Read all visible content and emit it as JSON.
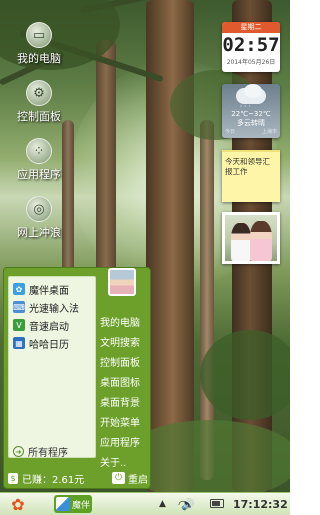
{
  "desktop_icons": [
    {
      "label": "我的电脑",
      "icon": "computer-icon"
    },
    {
      "label": "控制面板",
      "icon": "control-panel-icon"
    },
    {
      "label": "应用程序",
      "icon": "apps-icon"
    },
    {
      "label": "网上冲浪",
      "icon": "globe-icon"
    }
  ],
  "clock_widget": {
    "weekday": "星期二",
    "time": "02:57",
    "date": "2014年05月26日"
  },
  "weather_widget": {
    "temp": "22℃~32℃",
    "condition": "多云转晴",
    "left_label": "今日",
    "right_label": "上海市"
  },
  "note_widget": {
    "text": "今天和领导汇报工作"
  },
  "start_menu": {
    "left_items": [
      {
        "label": "魔伴桌面",
        "icon": "mobanzhuomian-icon",
        "color": "#3aa0e0"
      },
      {
        "label": "光速输入法",
        "icon": "keyboard-icon",
        "color": "#4c8fd6"
      },
      {
        "label": "音速启动",
        "icon": "launch-icon",
        "color": "#3a9d3a"
      },
      {
        "label": "哈哈日历",
        "icon": "calendar-icon",
        "color": "#2f6fbf"
      }
    ],
    "all_programs": "所有程序",
    "right_items": [
      "我的电脑",
      "文明搜索",
      "控制面板",
      "桌面图标",
      "桌面背景",
      "开始菜单",
      "应用程序",
      "关于.."
    ],
    "earned": "已赚：2.61元",
    "restart": "重启"
  },
  "taskbar": {
    "task_label": "魔伴",
    "time": "17:12:32"
  }
}
